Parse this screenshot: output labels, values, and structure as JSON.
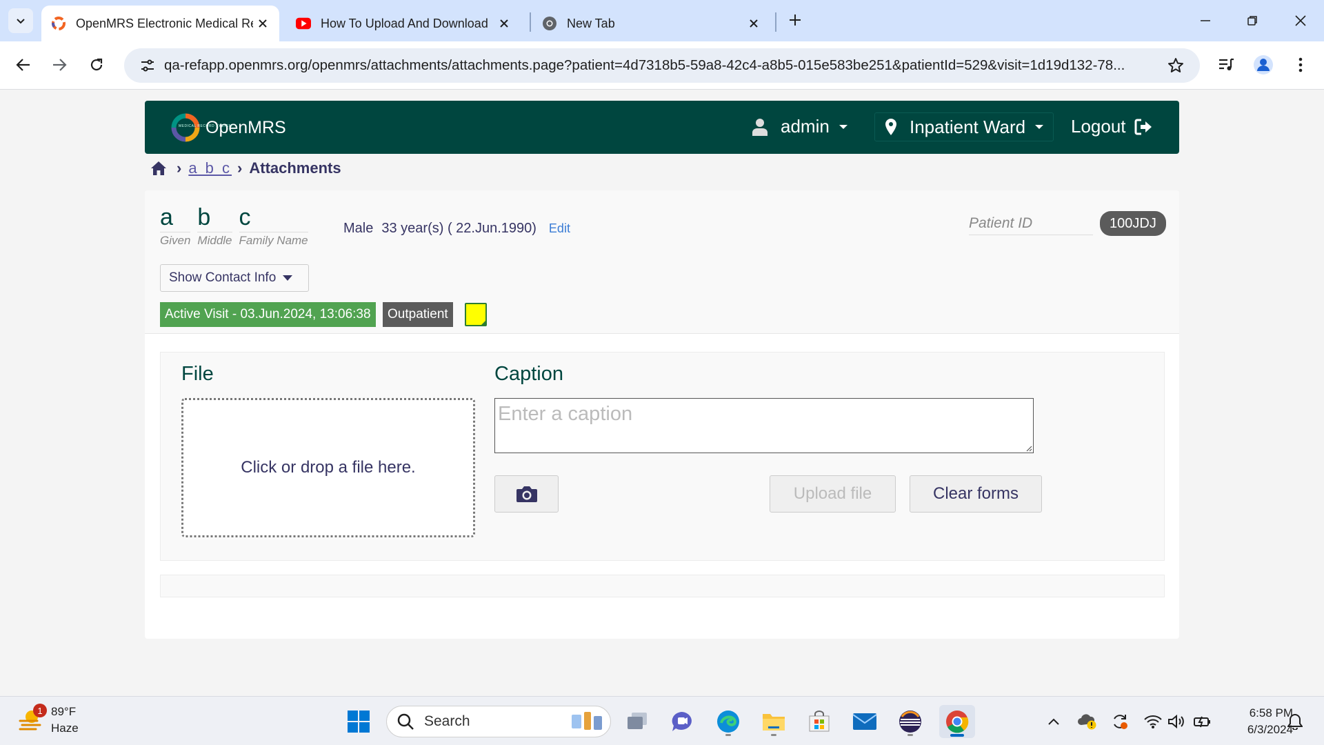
{
  "browser": {
    "tabs": [
      {
        "title": "OpenMRS Electronic Medical Re",
        "active": true
      },
      {
        "title": "How To Upload And Download",
        "active": false
      },
      {
        "title": "New Tab",
        "active": false
      }
    ],
    "url": "qa-refapp.openmrs.org/openmrs/attachments/attachments.page?patient=4d7318b5-59a8-42c4-a8b5-015e583be251&patientId=529&visit=1d19d132-78..."
  },
  "header": {
    "logo_text": "OpenMRS",
    "logo_sub": "MEDICAL RECORD SYSTEM",
    "user": "admin",
    "location": "Inpatient Ward",
    "logout": "Logout"
  },
  "breadcrumb": {
    "patient": "a b c",
    "current": "Attachments"
  },
  "patient": {
    "given": "a",
    "middle": "b",
    "family": "c",
    "given_label": "Given",
    "middle_label": "Middle",
    "family_label": "Family Name",
    "gender": "Male",
    "age_dob": "33 year(s) ( 22.Jun.1990)",
    "edit": "Edit",
    "id_label": "Patient ID",
    "id_value": "100JDJ",
    "contact_button": "Show Contact Info",
    "visit_tag": "Active Visit - 03.Jun.2024, 13:06:38",
    "visit_type": "Outpatient"
  },
  "upload": {
    "file_title": "File",
    "caption_title": "Caption",
    "dropzone_text": "Click or drop a file here.",
    "caption_placeholder": "Enter a caption",
    "upload_button": "Upload file",
    "clear_button": "Clear forms"
  },
  "taskbar": {
    "weather_temp": "89°F",
    "weather_cond": "Haze",
    "weather_badge": "1",
    "search_placeholder": "Search",
    "time": "6:58 PM",
    "date": "6/3/2024"
  },
  "colors": {
    "brand": "#00463f",
    "visit_green": "#51a351",
    "tag_gray": "#5b5b5b",
    "link_blue": "#3a7cd5",
    "text_navy": "#363463"
  }
}
